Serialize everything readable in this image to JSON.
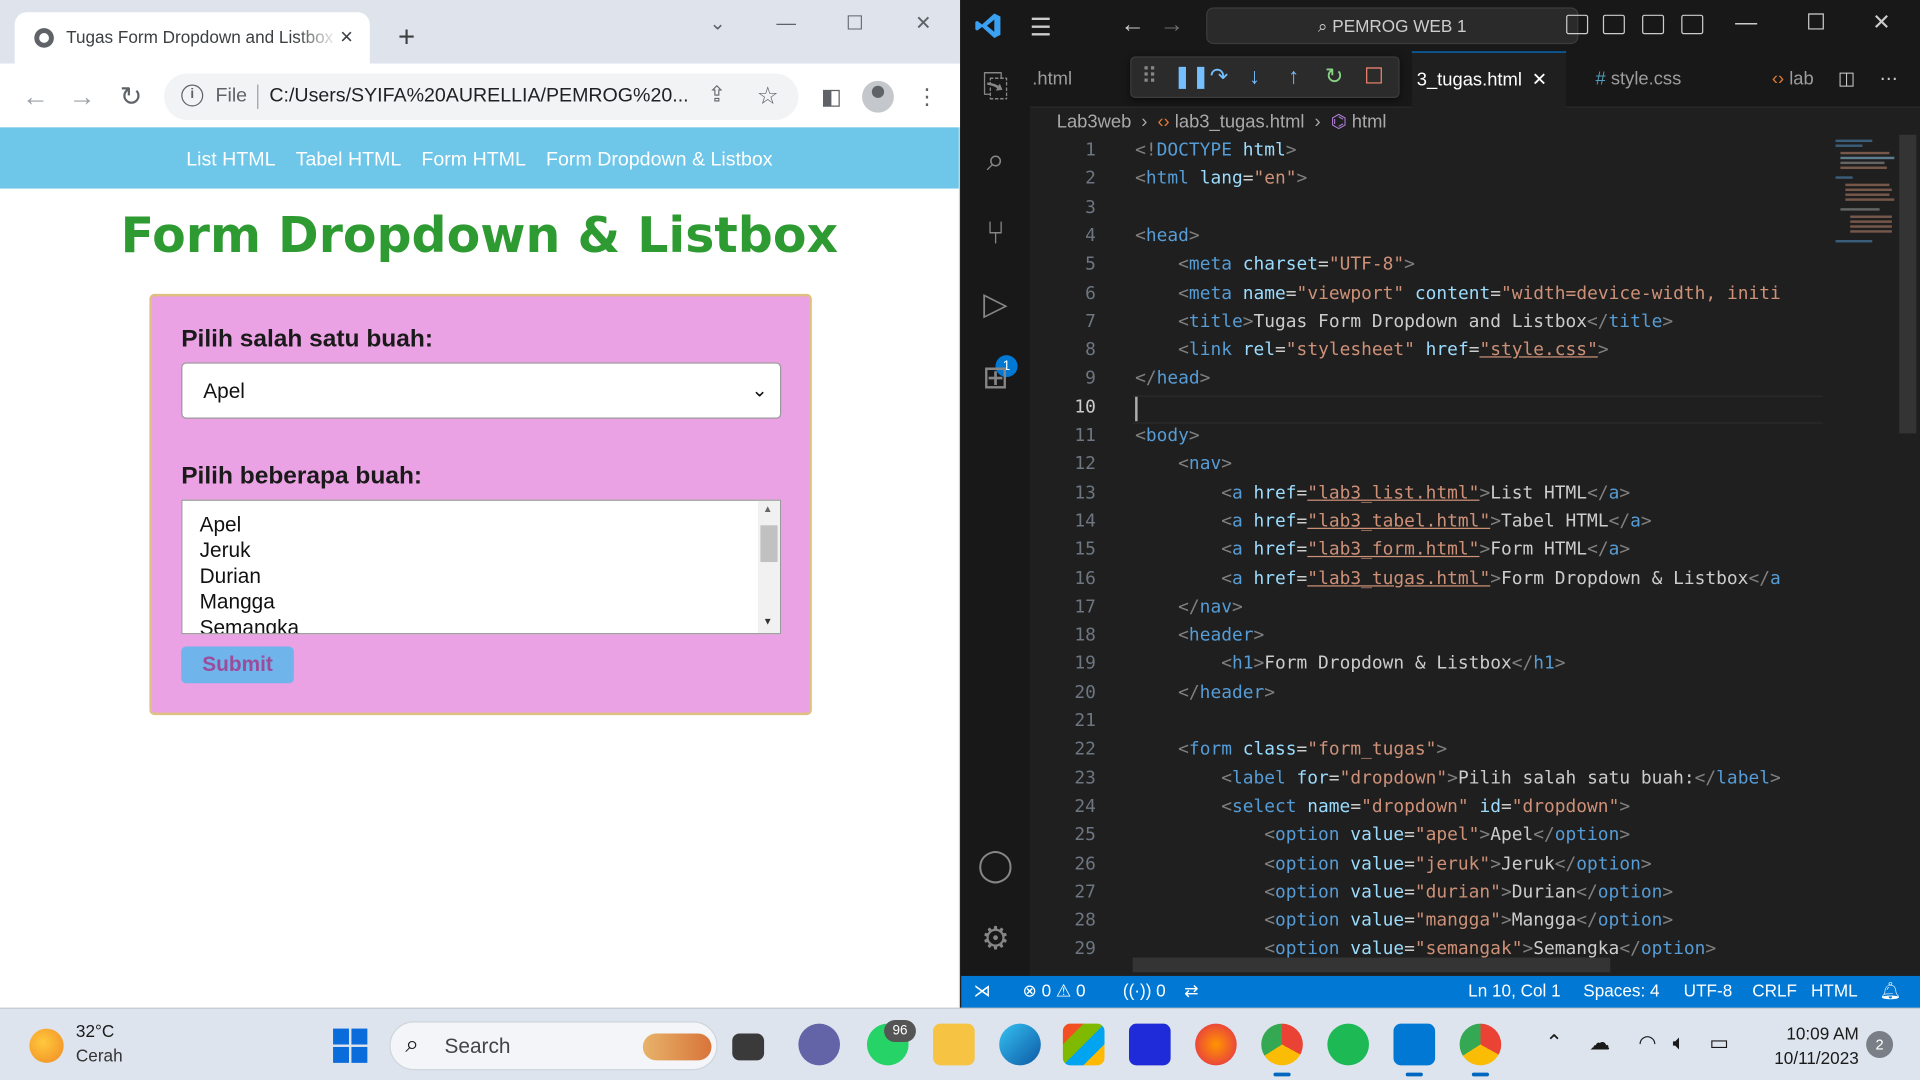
{
  "browser": {
    "tab_title": "Tugas Form Dropdown and Listbox",
    "url_scheme": "File",
    "url": "C:/Users/SYIFA%20AURELLIA/PEMROG%20..."
  },
  "page": {
    "nav": [
      "List HTML",
      "Tabel HTML",
      "Form HTML",
      "Form Dropdown & Listbox"
    ],
    "heading": "Form Dropdown & Listbox",
    "dropdown_label": "Pilih salah satu buah:",
    "dropdown_value": "Apel",
    "listbox_label": "Pilih beberapa buah:",
    "listbox_options": [
      "Apel",
      "Jeruk",
      "Durian",
      "Mangga",
      "Semangka"
    ],
    "submit_label": "Submit"
  },
  "vscode": {
    "command_center": "PEMROG WEB 1",
    "tabs": [
      ".html",
      "3_tugas.html",
      "style.css",
      "lab"
    ],
    "debug_badge": "1",
    "breadcrumb": [
      "Lab3web",
      "lab3_tugas.html",
      "html"
    ],
    "current_line": 10,
    "code_lines": [
      [
        [
          "t",
          "<!"
        ],
        [
          "k",
          "DOCTYPE"
        ],
        [
          "a",
          " html"
        ],
        [
          "t",
          ">"
        ]
      ],
      [
        [
          "t",
          "<"
        ],
        [
          "k",
          "html"
        ],
        [
          "a",
          " lang"
        ],
        [
          "p",
          "="
        ],
        [
          "s",
          "\"en\""
        ],
        [
          "t",
          ">"
        ]
      ],
      [],
      [
        [
          "t",
          "<"
        ],
        [
          "k",
          "head"
        ],
        [
          "t",
          ">"
        ]
      ],
      [
        [
          "p",
          "    "
        ],
        [
          "t",
          "<"
        ],
        [
          "k",
          "meta"
        ],
        [
          "a",
          " charset"
        ],
        [
          "p",
          "="
        ],
        [
          "s",
          "\"UTF-8\""
        ],
        [
          "t",
          ">"
        ]
      ],
      [
        [
          "p",
          "    "
        ],
        [
          "t",
          "<"
        ],
        [
          "k",
          "meta"
        ],
        [
          "a",
          " name"
        ],
        [
          "p",
          "="
        ],
        [
          "s",
          "\"viewport\""
        ],
        [
          "a",
          " content"
        ],
        [
          "p",
          "="
        ],
        [
          "s",
          "\"width=device-width, initi"
        ]
      ],
      [
        [
          "p",
          "    "
        ],
        [
          "t",
          "<"
        ],
        [
          "k",
          "title"
        ],
        [
          "t",
          ">"
        ],
        [
          "p",
          "Tugas Form Dropdown and Listbox"
        ],
        [
          "t",
          "</"
        ],
        [
          "k",
          "title"
        ],
        [
          "t",
          ">"
        ]
      ],
      [
        [
          "p",
          "    "
        ],
        [
          "t",
          "<"
        ],
        [
          "k",
          "link"
        ],
        [
          "a",
          " rel"
        ],
        [
          "p",
          "="
        ],
        [
          "s",
          "\"stylesheet\""
        ],
        [
          "a",
          " href"
        ],
        [
          "p",
          "="
        ],
        [
          "u",
          "\"style.css\""
        ],
        [
          "t",
          ">"
        ]
      ],
      [
        [
          "t",
          "</"
        ],
        [
          "k",
          "head"
        ],
        [
          "t",
          ">"
        ]
      ],
      [],
      [
        [
          "t",
          "<"
        ],
        [
          "k",
          "body"
        ],
        [
          "t",
          ">"
        ]
      ],
      [
        [
          "p",
          "    "
        ],
        [
          "t",
          "<"
        ],
        [
          "k",
          "nav"
        ],
        [
          "t",
          ">"
        ]
      ],
      [
        [
          "p",
          "        "
        ],
        [
          "t",
          "<"
        ],
        [
          "k",
          "a"
        ],
        [
          "a",
          " href"
        ],
        [
          "p",
          "="
        ],
        [
          "u",
          "\"lab3_list.html\""
        ],
        [
          "t",
          ">"
        ],
        [
          "p",
          "List HTML"
        ],
        [
          "t",
          "</"
        ],
        [
          "k",
          "a"
        ],
        [
          "t",
          ">"
        ]
      ],
      [
        [
          "p",
          "        "
        ],
        [
          "t",
          "<"
        ],
        [
          "k",
          "a"
        ],
        [
          "a",
          " href"
        ],
        [
          "p",
          "="
        ],
        [
          "u",
          "\"lab3_tabel.html\""
        ],
        [
          "t",
          ">"
        ],
        [
          "p",
          "Tabel HTML"
        ],
        [
          "t",
          "</"
        ],
        [
          "k",
          "a"
        ],
        [
          "t",
          ">"
        ]
      ],
      [
        [
          "p",
          "        "
        ],
        [
          "t",
          "<"
        ],
        [
          "k",
          "a"
        ],
        [
          "a",
          " href"
        ],
        [
          "p",
          "="
        ],
        [
          "u",
          "\"lab3_form.html\""
        ],
        [
          "t",
          ">"
        ],
        [
          "p",
          "Form HTML"
        ],
        [
          "t",
          "</"
        ],
        [
          "k",
          "a"
        ],
        [
          "t",
          ">"
        ]
      ],
      [
        [
          "p",
          "        "
        ],
        [
          "t",
          "<"
        ],
        [
          "k",
          "a"
        ],
        [
          "a",
          " href"
        ],
        [
          "p",
          "="
        ],
        [
          "u",
          "\"lab3_tugas.html\""
        ],
        [
          "t",
          ">"
        ],
        [
          "p",
          "Form Dropdown & Listbox"
        ],
        [
          "t",
          "</"
        ],
        [
          "k",
          "a"
        ]
      ],
      [
        [
          "p",
          "    "
        ],
        [
          "t",
          "</"
        ],
        [
          "k",
          "nav"
        ],
        [
          "t",
          ">"
        ]
      ],
      [
        [
          "p",
          "    "
        ],
        [
          "t",
          "<"
        ],
        [
          "k",
          "header"
        ],
        [
          "t",
          ">"
        ]
      ],
      [
        [
          "p",
          "        "
        ],
        [
          "t",
          "<"
        ],
        [
          "k",
          "h1"
        ],
        [
          "t",
          ">"
        ],
        [
          "p",
          "Form Dropdown & Listbox"
        ],
        [
          "t",
          "</"
        ],
        [
          "k",
          "h1"
        ],
        [
          "t",
          ">"
        ]
      ],
      [
        [
          "p",
          "    "
        ],
        [
          "t",
          "</"
        ],
        [
          "k",
          "header"
        ],
        [
          "t",
          ">"
        ]
      ],
      [],
      [
        [
          "p",
          "    "
        ],
        [
          "t",
          "<"
        ],
        [
          "k",
          "form"
        ],
        [
          "a",
          " class"
        ],
        [
          "p",
          "="
        ],
        [
          "s",
          "\"form_tugas\""
        ],
        [
          "t",
          ">"
        ]
      ],
      [
        [
          "p",
          "        "
        ],
        [
          "t",
          "<"
        ],
        [
          "k",
          "label"
        ],
        [
          "a",
          " for"
        ],
        [
          "p",
          "="
        ],
        [
          "s",
          "\"dropdown\""
        ],
        [
          "t",
          ">"
        ],
        [
          "p",
          "Pilih salah satu buah:"
        ],
        [
          "t",
          "</"
        ],
        [
          "k",
          "label"
        ],
        [
          "t",
          ">"
        ]
      ],
      [
        [
          "p",
          "        "
        ],
        [
          "t",
          "<"
        ],
        [
          "k",
          "select"
        ],
        [
          "a",
          " name"
        ],
        [
          "p",
          "="
        ],
        [
          "s",
          "\"dropdown\""
        ],
        [
          "a",
          " id"
        ],
        [
          "p",
          "="
        ],
        [
          "s",
          "\"dropdown\""
        ],
        [
          "t",
          ">"
        ]
      ],
      [
        [
          "p",
          "            "
        ],
        [
          "t",
          "<"
        ],
        [
          "k",
          "option"
        ],
        [
          "a",
          " value"
        ],
        [
          "p",
          "="
        ],
        [
          "s",
          "\"apel\""
        ],
        [
          "t",
          ">"
        ],
        [
          "p",
          "Apel"
        ],
        [
          "t",
          "</"
        ],
        [
          "k",
          "option"
        ],
        [
          "t",
          ">"
        ]
      ],
      [
        [
          "p",
          "            "
        ],
        [
          "t",
          "<"
        ],
        [
          "k",
          "option"
        ],
        [
          "a",
          " value"
        ],
        [
          "p",
          "="
        ],
        [
          "s",
          "\"jeruk\""
        ],
        [
          "t",
          ">"
        ],
        [
          "p",
          "Jeruk"
        ],
        [
          "t",
          "</"
        ],
        [
          "k",
          "option"
        ],
        [
          "t",
          ">"
        ]
      ],
      [
        [
          "p",
          "            "
        ],
        [
          "t",
          "<"
        ],
        [
          "k",
          "option"
        ],
        [
          "a",
          " value"
        ],
        [
          "p",
          "="
        ],
        [
          "s",
          "\"durian\""
        ],
        [
          "t",
          ">"
        ],
        [
          "p",
          "Durian"
        ],
        [
          "t",
          "</"
        ],
        [
          "k",
          "option"
        ],
        [
          "t",
          ">"
        ]
      ],
      [
        [
          "p",
          "            "
        ],
        [
          "t",
          "<"
        ],
        [
          "k",
          "option"
        ],
        [
          "a",
          " value"
        ],
        [
          "p",
          "="
        ],
        [
          "s",
          "\"mangga\""
        ],
        [
          "t",
          ">"
        ],
        [
          "p",
          "Mangga"
        ],
        [
          "t",
          "</"
        ],
        [
          "k",
          "option"
        ],
        [
          "t",
          ">"
        ]
      ],
      [
        [
          "p",
          "            "
        ],
        [
          "t",
          "<"
        ],
        [
          "k",
          "option"
        ],
        [
          "a",
          " value"
        ],
        [
          "p",
          "="
        ],
        [
          "s",
          "\"semangak\""
        ],
        [
          "t",
          ">"
        ],
        [
          "p",
          "Semangka"
        ],
        [
          "t",
          "</"
        ],
        [
          "k",
          "option"
        ],
        [
          "t",
          ">"
        ]
      ]
    ],
    "status": {
      "errors": "0",
      "warnings": "0",
      "ports": "0",
      "position": "Ln 10, Col 1",
      "spaces": "Spaces: 4",
      "encoding": "UTF-8",
      "eol": "CRLF",
      "language": "HTML"
    },
    "colors": {
      "accent": "#0078d4",
      "tag": "#808080",
      "keyword": "#569cd6",
      "attr": "#9cdcfe",
      "string": "#ce9178"
    }
  },
  "taskbar": {
    "temperature": "32°C",
    "condition": "Cerah",
    "search": "Search",
    "whatsapp_badge": "96",
    "time": "10:09 AM",
    "date": "10/11/2023",
    "notifications": "2"
  }
}
